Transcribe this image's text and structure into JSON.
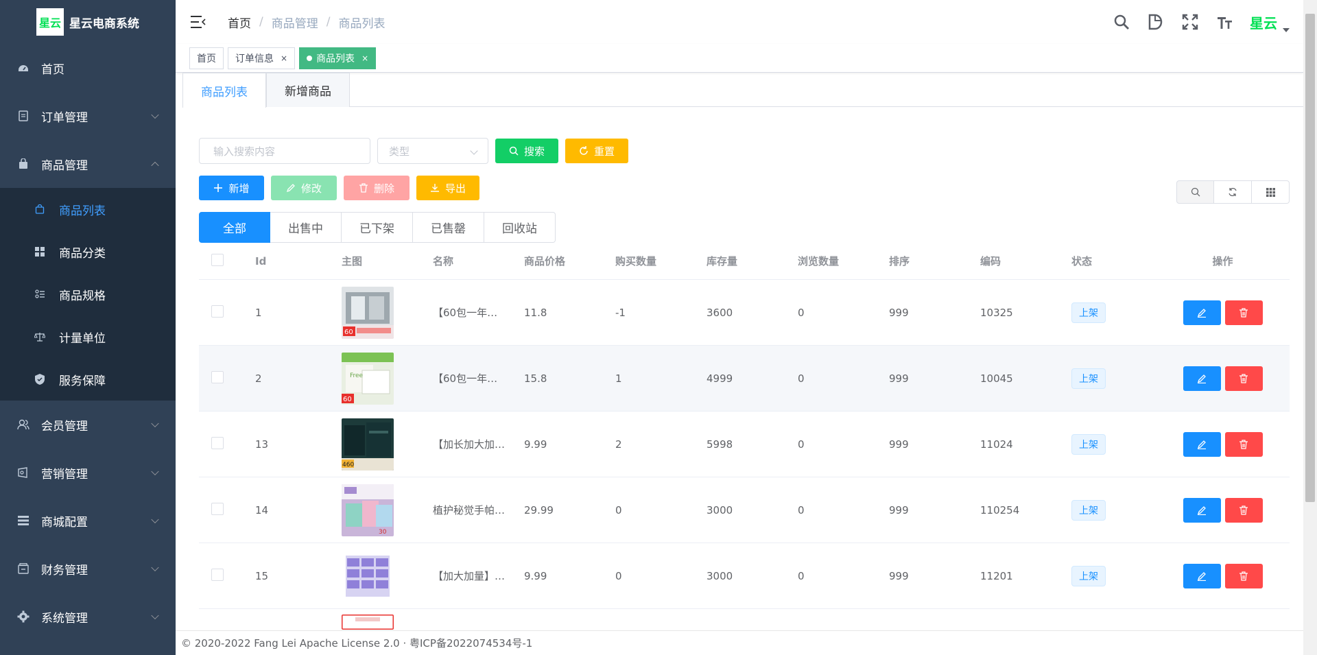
{
  "brand": {
    "logo_text": "星云",
    "title": "星云电商系统"
  },
  "sidebar": {
    "items": [
      {
        "label": "首页",
        "icon": "dashboard-icon"
      },
      {
        "label": "订单管理",
        "icon": "order-icon"
      },
      {
        "label": "商品管理",
        "icon": "bag-icon",
        "expanded": true
      },
      {
        "label": "会员管理",
        "icon": "users-icon"
      },
      {
        "label": "营销管理",
        "icon": "marketing-icon"
      },
      {
        "label": "商城配置",
        "icon": "list-icon"
      },
      {
        "label": "财务管理",
        "icon": "finance-icon"
      },
      {
        "label": "系统管理",
        "icon": "gear-icon"
      }
    ],
    "sub_items": [
      {
        "label": "商品列表",
        "icon": "bag-small-icon",
        "active": true
      },
      {
        "label": "商品分类",
        "icon": "grid-icon"
      },
      {
        "label": "商品规格",
        "icon": "spec-icon"
      },
      {
        "label": "计量单位",
        "icon": "scale-icon"
      },
      {
        "label": "服务保障",
        "icon": "shield-icon"
      }
    ]
  },
  "navbar": {
    "breadcrumb": [
      "首页",
      "商品管理",
      "商品列表"
    ],
    "separator": "/",
    "avatar_text": "星云"
  },
  "tags": [
    {
      "label": "首页"
    },
    {
      "label": "订单信息",
      "close": "×"
    },
    {
      "label": "商品列表",
      "close": "×",
      "active": true
    }
  ],
  "tabs": [
    "商品列表",
    "新增商品"
  ],
  "search": {
    "placeholder": "输入搜索内容",
    "type_placeholder": "类型",
    "search_label": "搜索",
    "reset_label": "重置"
  },
  "actions": {
    "add": "新增",
    "edit": "修改",
    "delete": "删除",
    "export": "导出"
  },
  "status_tabs": [
    "全部",
    "出售中",
    "已下架",
    "已售罄",
    "回收站"
  ],
  "table": {
    "headers": [
      "Id",
      "主图",
      "名称",
      "商品价格",
      "购买数量",
      "库存量",
      "浏览数量",
      "排序",
      "编码",
      "状态",
      "操作"
    ],
    "rows": [
      {
        "id": "1",
        "name": "【60包一年…",
        "price": "11.8",
        "buy": "-1",
        "stock": "3600",
        "views": "0",
        "sort": "999",
        "code": "10325",
        "status": "上架"
      },
      {
        "id": "2",
        "name": "【60包一年…",
        "price": "15.8",
        "buy": "1",
        "stock": "4999",
        "views": "0",
        "sort": "999",
        "code": "10045",
        "status": "上架"
      },
      {
        "id": "13",
        "name": "【加长加大加…",
        "price": "9.99",
        "buy": "2",
        "stock": "5998",
        "views": "0",
        "sort": "999",
        "code": "11024",
        "status": "上架"
      },
      {
        "id": "14",
        "name": "植护秘觉手帕…",
        "price": "29.99",
        "buy": "0",
        "stock": "3000",
        "views": "0",
        "sort": "999",
        "code": "110254",
        "status": "上架"
      },
      {
        "id": "15",
        "name": "【加大加量】…",
        "price": "9.99",
        "buy": "0",
        "stock": "3000",
        "views": "0",
        "sort": "999",
        "code": "11201",
        "status": "上架"
      }
    ]
  },
  "footer": {
    "text": "© 2020-2022 Fang Lei Apache License 2.0 · 粤ICP备2022074534号-1"
  },
  "colors": {
    "sidebar_bg": "#304156",
    "primary": "#1890ff",
    "success": "#13ce66",
    "warning": "#ffba00",
    "danger": "#ff4949",
    "tag_active": "#42b983"
  }
}
